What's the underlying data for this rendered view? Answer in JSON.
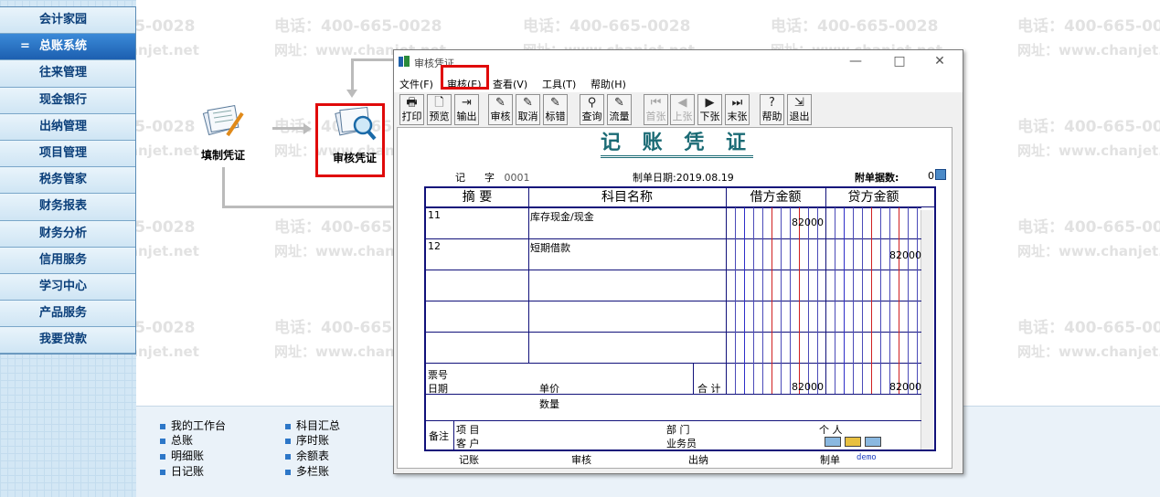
{
  "watermark": {
    "phone": "电话：400-665-0028",
    "site": "网址：www.chanjet.net"
  },
  "sidebar": {
    "items": [
      {
        "label": "会计家园"
      },
      {
        "label": "总账系统",
        "active": true,
        "prefix": "="
      },
      {
        "label": "往来管理"
      },
      {
        "label": "现金银行"
      },
      {
        "label": "出纳管理"
      },
      {
        "label": "项目管理"
      },
      {
        "label": "税务管家"
      },
      {
        "label": "财务报表"
      },
      {
        "label": "财务分析"
      },
      {
        "label": "信用服务"
      },
      {
        "label": "学习中心"
      },
      {
        "label": "产品服务"
      },
      {
        "label": "我要贷款"
      }
    ]
  },
  "flow": {
    "fill_voucher": "填制凭证",
    "audit_voucher": "审核凭证"
  },
  "bottom_links": {
    "col1": [
      "我的工作台",
      "总账",
      "明细账",
      "日记账"
    ],
    "col2": [
      "科目汇总",
      "序时账",
      "余额表",
      "多栏账"
    ]
  },
  "dialog": {
    "title": "审核凭证",
    "window_buttons": {
      "minimize": "—",
      "maximize": "□",
      "close": "✕"
    },
    "menu": [
      "文件(F)",
      "审核(E)",
      "查看(V)",
      "工具(T)",
      "帮助(H)"
    ],
    "toolbar": [
      {
        "label": "打印",
        "icon": "🖶",
        "name": "print"
      },
      {
        "label": "预览",
        "icon": "🗋",
        "name": "preview"
      },
      {
        "label": "输出",
        "icon": "⇥",
        "name": "export"
      },
      {
        "label": "审核",
        "icon": "✎",
        "name": "audit"
      },
      {
        "label": "取消",
        "icon": "✎",
        "name": "cancel"
      },
      {
        "label": "标错",
        "icon": "✎",
        "name": "mark-error"
      },
      {
        "label": "查询",
        "icon": "⚲",
        "name": "query"
      },
      {
        "label": "流量",
        "icon": "✎",
        "name": "cashflow"
      },
      {
        "label": "首张",
        "icon": "⏮",
        "name": "first",
        "disabled": true
      },
      {
        "label": "上张",
        "icon": "◀",
        "name": "prev",
        "disabled": true
      },
      {
        "label": "下张",
        "icon": "▶",
        "name": "next"
      },
      {
        "label": "末张",
        "icon": "⏭",
        "name": "last"
      },
      {
        "label": "帮助",
        "icon": "?",
        "name": "help"
      },
      {
        "label": "退出",
        "icon": "⇲",
        "name": "exit"
      }
    ],
    "voucher": {
      "title": "记 账 凭 证",
      "type_label": "记",
      "zi_label": "字",
      "number": "0001",
      "date_label": "制单日期:",
      "date": "2019.08.19",
      "attachments_label": "附单据数:",
      "attachments": "0",
      "headers": {
        "summary": "摘 要",
        "account": "科目名称",
        "debit": "借方金额",
        "credit": "贷方金额"
      },
      "rows": [
        {
          "summary": "11",
          "account": "库存现金/现金",
          "debit": "82000",
          "credit": ""
        },
        {
          "summary": "12",
          "account": "短期借款",
          "debit": "",
          "credit": "82000"
        },
        {
          "summary": "",
          "account": "",
          "debit": "",
          "credit": ""
        },
        {
          "summary": "",
          "account": "",
          "debit": "",
          "credit": ""
        },
        {
          "summary": "",
          "account": "",
          "debit": "",
          "credit": ""
        }
      ],
      "footer": {
        "ticket_no": "票号",
        "date": "日期",
        "unit_price": "单价",
        "quantity": "数量",
        "total_label": "合 计",
        "total_debit": "82000",
        "total_credit": "82000"
      },
      "remarks": {
        "label": "备注",
        "project": "项  目",
        "customer": "客  户",
        "department": "部  门",
        "salesperson": "业务员",
        "person": "个  人"
      },
      "signatures": {
        "bookkeeping": "记账",
        "audit": "审核",
        "cashier": "出纳",
        "prepared": "制单",
        "preparer": "demo"
      }
    }
  },
  "colors": {
    "highlight": "#e00a0a",
    "voucher_title": "#1b6b75",
    "grid": "#11117a",
    "sidebar_active": "#1c5fb0"
  }
}
